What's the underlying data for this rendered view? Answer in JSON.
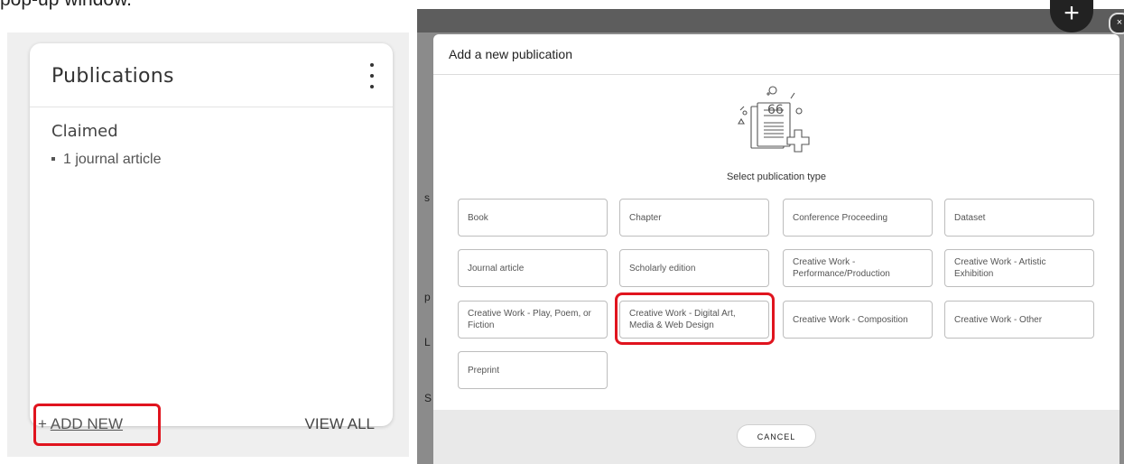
{
  "caption": "pop-up window.",
  "card": {
    "title": "Publications",
    "section_heading": "Claimed",
    "claimed_item": "1 journal article",
    "add_new_plus": "+",
    "add_new_label": "ADD NEW",
    "view_all_label": "VIEW ALL"
  },
  "background": {
    "plus_symbol": "+",
    "close_symbol": "×",
    "edge_letters": [
      "s",
      "p",
      "L",
      "S"
    ]
  },
  "dialog": {
    "title": "Add a new publication",
    "select_label": "Select publication type",
    "types": [
      "Book",
      "Chapter",
      "Conference Proceeding",
      "Dataset",
      "Journal article",
      "Scholarly edition",
      "Creative Work - Performance/Production",
      "Creative Work - Artistic Exhibition",
      "Creative Work - Play, Poem, or Fiction",
      "Creative Work - Digital Art, Media & Web Design",
      "Creative Work - Composition",
      "Creative Work - Other",
      "Preprint"
    ],
    "cancel_label": "CANCEL"
  },
  "colors": {
    "highlight": "#e0141e",
    "overlay": "#8b8b8b",
    "footer": "#e9e9e9"
  }
}
